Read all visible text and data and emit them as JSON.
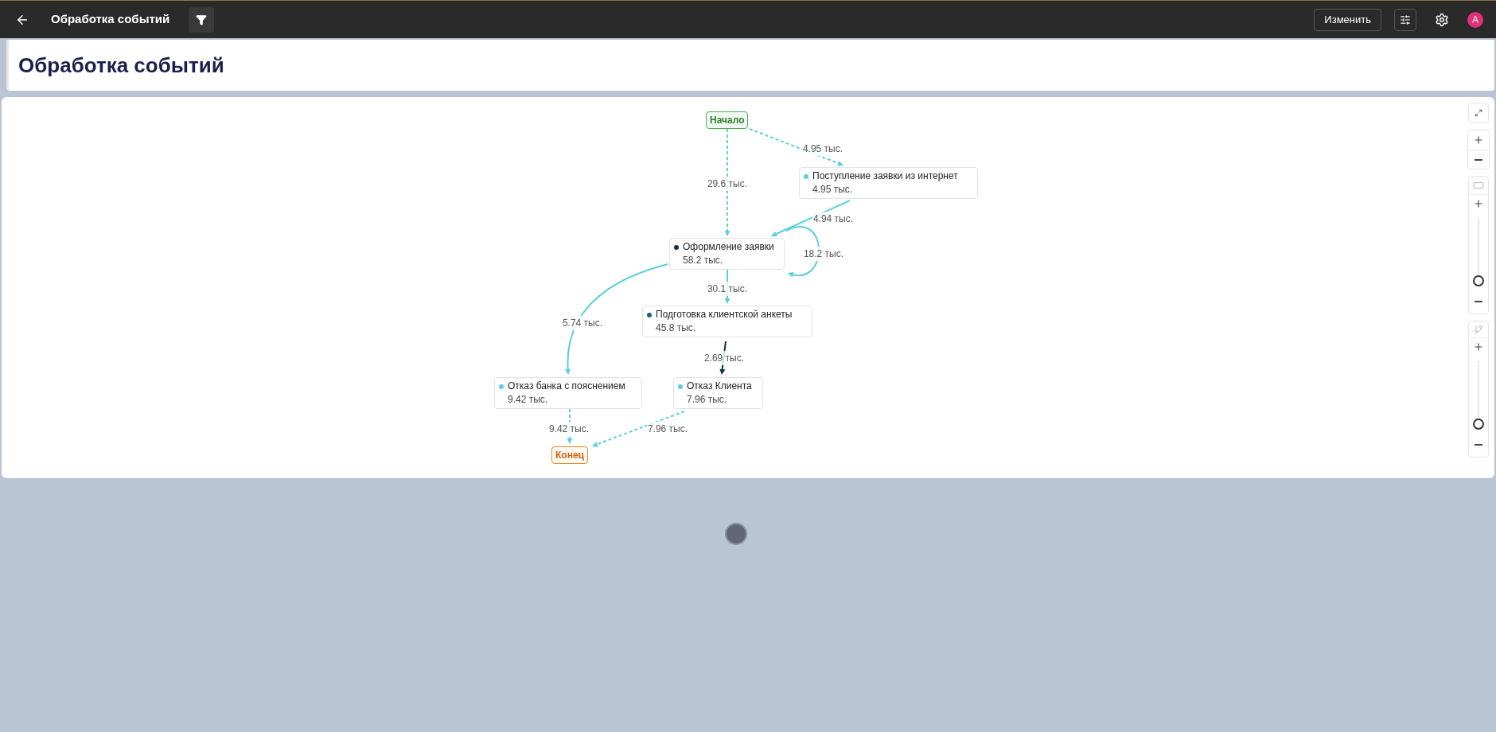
{
  "header": {
    "title": "Обработка событий",
    "edit_button": "Изменить",
    "avatar": "A"
  },
  "page_title": "Обработка событий",
  "graph": {
    "nodes": [
      {
        "kind": "start",
        "label": "Начало"
      },
      {
        "kind": "activity",
        "label": "Поступление заявки из интернет",
        "count": "4.95 тыс.",
        "color": "#5ad0dc"
      },
      {
        "kind": "activity",
        "label": "Оформление заявки",
        "count": "58.2 тыс.",
        "color": "#0b3440"
      },
      {
        "kind": "activity",
        "label": "Подготовка клиентской анкеты",
        "count": "45.8 тыс.",
        "color": "#1d5f80"
      },
      {
        "kind": "activity",
        "label": "Отказ банка с пояснением",
        "count": "9.42 тыс.",
        "color": "#5ad0dc"
      },
      {
        "kind": "activity",
        "label": "Отказ Клиента",
        "count": "7.96 тыс.",
        "color": "#5ad0dc"
      },
      {
        "kind": "end",
        "label": "Конец"
      }
    ],
    "edges": [
      {
        "label": "29.6 тыс.",
        "dashed": true,
        "color": "#5ad0dc"
      },
      {
        "label": "4.95 тыс.",
        "dashed": true,
        "color": "#5ad0dc"
      },
      {
        "label": "4.94 тыс.",
        "dashed": false,
        "color": "#5ad0dc"
      },
      {
        "label": "18.2 тыс.",
        "dashed": false,
        "color": "#5ad0dc"
      },
      {
        "label": "30.1 тыс.",
        "dashed": false,
        "color": "#5ad0dc"
      },
      {
        "label": "5.74 тыс.",
        "dashed": false,
        "color": "#5ad0dc"
      },
      {
        "label": "2.69 тыс.",
        "dashed": false,
        "color": "#0b3440"
      },
      {
        "label": "9.42 тыс.",
        "dashed": true,
        "color": "#5ad0dc"
      },
      {
        "label": "7.96 тыс.",
        "dashed": true,
        "color": "#5ad0dc"
      }
    ]
  },
  "controls": {
    "activity_slider": {
      "level": 0
    },
    "path_slider": {
      "level": 0
    }
  }
}
